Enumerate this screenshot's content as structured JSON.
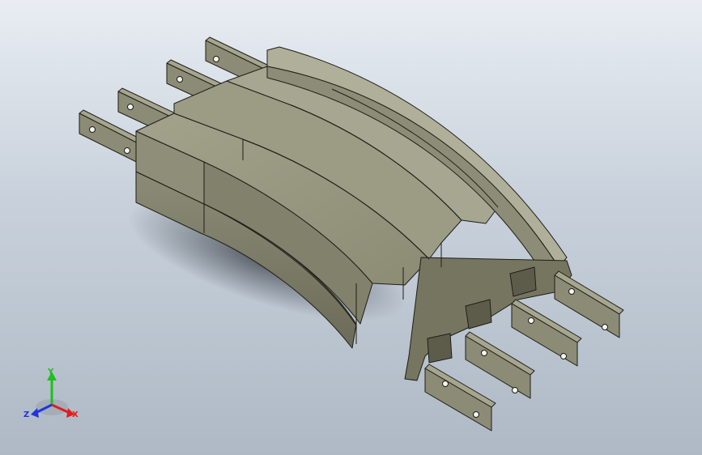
{
  "viewport": {
    "background_top": "#e9edf3",
    "background_bottom": "#aeb9c5"
  },
  "model": {
    "name": "curved-busbar-assembly",
    "face_color": "#8a8a72",
    "top_color": "#9b9a82",
    "side_color": "#6f6f5c",
    "edge_color": "#1e1e18"
  },
  "triad": {
    "x_label": "X",
    "y_label": "Y",
    "z_label": "Z",
    "x_color": "#e01e1e",
    "y_color": "#1fbf1f",
    "z_color": "#2233dd"
  }
}
